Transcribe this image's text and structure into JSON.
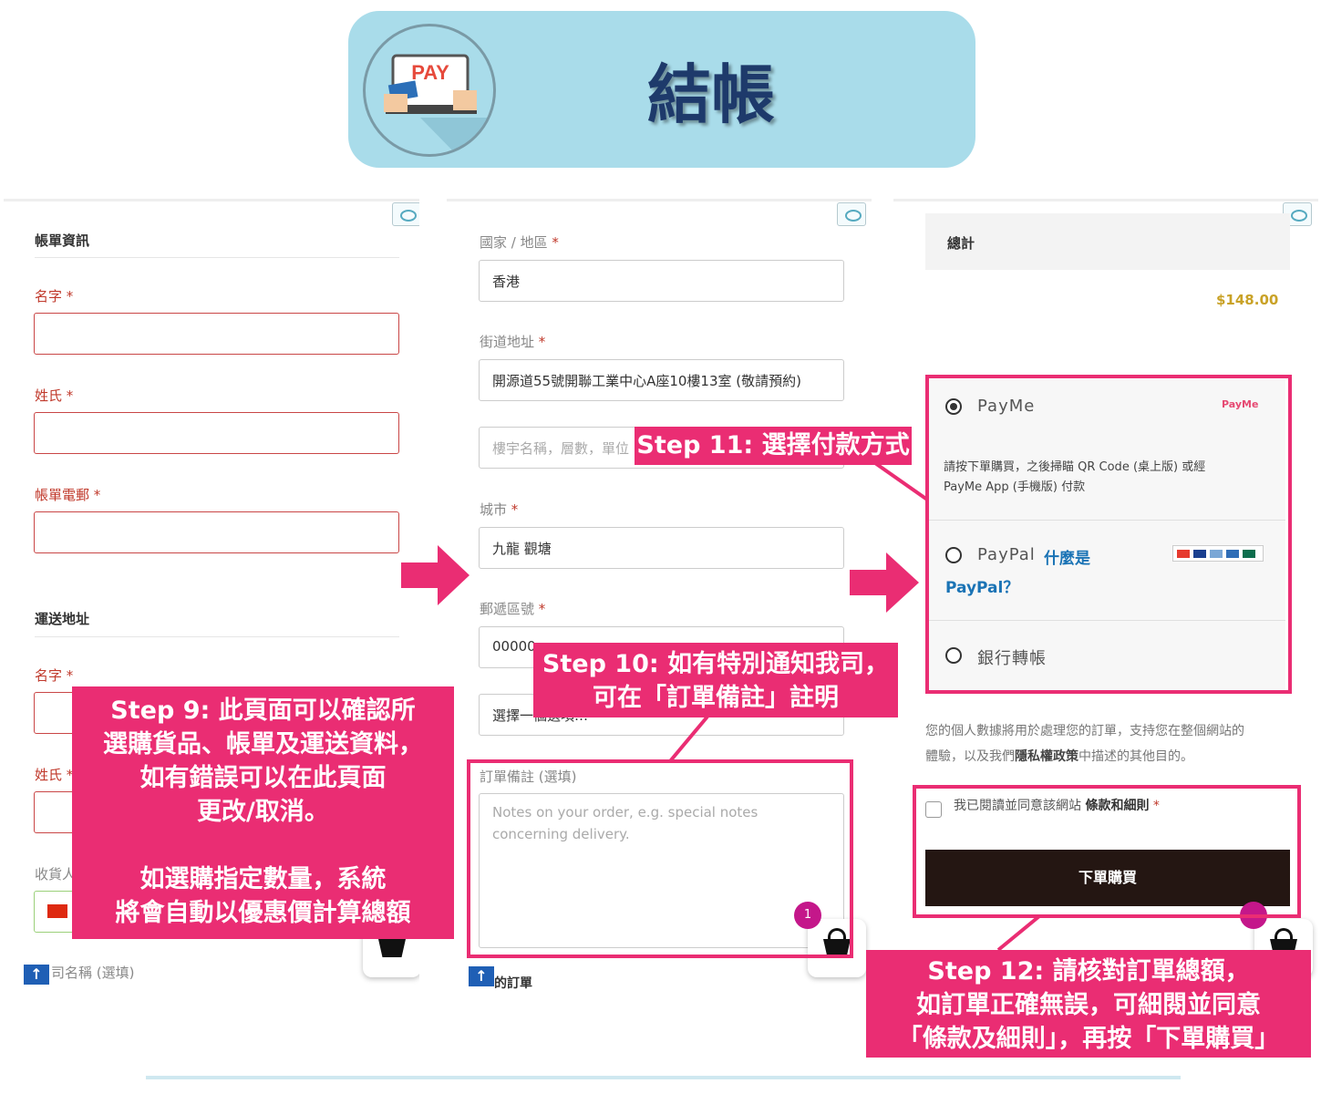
{
  "header": {
    "title": "結帳",
    "pay_label": "PAY"
  },
  "panel1": {
    "billing_heading": "帳單資訊",
    "first_name_label": "名字",
    "last_name_label": "姓氏",
    "email_label": "帳單電郵",
    "required_mark": "*",
    "shipping_heading": "運送地址",
    "ship_first_name_label": "名字",
    "ship_last_name_label": "姓氏",
    "recipient_label": "收貨人",
    "company_label": "司名稱 (選填)",
    "up_glyph": "↑"
  },
  "panel2": {
    "country_label": "國家 / 地區",
    "country_value": "香港",
    "street_label": "街道地址",
    "street_value": "開源道55號開聯工業中心A座10樓13室 (敬請預約)",
    "street2_placeholder": "樓宇名稱，層數，單位",
    "city_label": "城市",
    "city_value": "九龍 觀塘",
    "postal_label": "郵遞區號",
    "postal_value": "00000",
    "select_value": "選擇一個選項…",
    "notes_label": "訂單備註 (選填)",
    "notes_placeholder": "Notes on your order, e.g. special notes concerning delivery.",
    "your_order": "的訂單",
    "cart_badge": "1",
    "up_glyph": "↑"
  },
  "panel3": {
    "total_label": "總計",
    "total_value": "$148.00",
    "payme_name": "PayMe",
    "payme_logo": "PayMe",
    "payme_desc": "請按下單購買，之後掃瞄 QR Code (桌上版) 或經 PayMe App (手機版) 付款",
    "paypal_name": "PayPal",
    "paypal_link_1": "什麼是",
    "paypal_link_2": "PayPal？",
    "bank_name": "銀行轉帳",
    "privacy_text_1": "您的個人數據將用於處理您的訂單，支持您在整個網站的",
    "privacy_text_2": "體驗，以及我們",
    "privacy_link": "隱私權政策",
    "privacy_text_3": "中描述的其他目的。",
    "terms_text": "我已閱讀並同意該網站",
    "terms_link": "條款和細則",
    "required_mark": "*",
    "place_order": "下單購買"
  },
  "callouts": {
    "step9": "Step 9: 此頁面可以確認所\n選購貨品、帳單及運送資料，\n如有錯誤可以在此頁面\n更改/取消。\n\n如選購指定數量，系統\n將會自動以優惠價計算總額",
    "step10": "Step 10: 如有特別通知我司，\n可在「訂單備註」註明",
    "step11": "Step 11: 選擇付款方式",
    "step12": "Step 12: 請核對訂單總額，\n如訂單正確無誤，可細閱並同意\n「條款及細則」，再按「下單購買」"
  },
  "colors": {
    "accent": "#ea2d73",
    "header_bg": "#a9dcea",
    "title": "#1e3a6b",
    "price": "#c9a227",
    "link": "#1a73b5",
    "button": "#241612"
  }
}
